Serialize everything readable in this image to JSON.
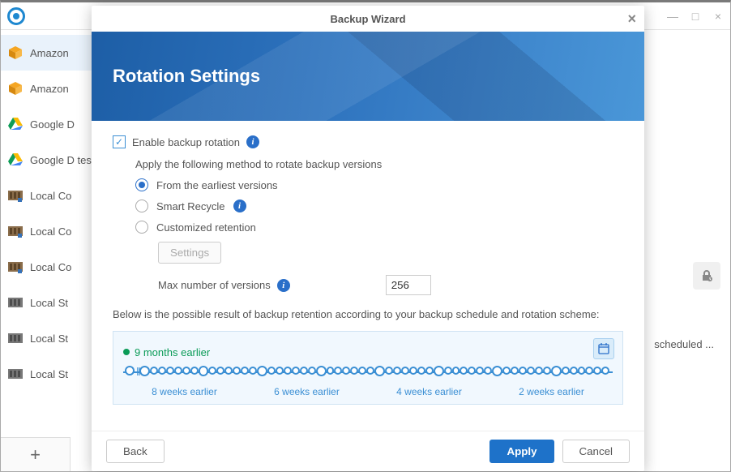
{
  "bg_window": {
    "controls": {
      "min": "—",
      "max": "□",
      "close": "×"
    }
  },
  "sidebar": {
    "items": [
      {
        "label": "Amazon"
      },
      {
        "label": "Amazon"
      },
      {
        "label": "Google D"
      },
      {
        "label": "Google D test"
      },
      {
        "label": "Local Co"
      },
      {
        "label": "Local Co"
      },
      {
        "label": "Local Co"
      },
      {
        "label": "Local St"
      },
      {
        "label": "Local St"
      },
      {
        "label": "Local St"
      }
    ]
  },
  "main": {
    "scheduled_text": "scheduled ..."
  },
  "modal": {
    "title": "Backup Wizard",
    "banner_title": "Rotation Settings",
    "enable_label": "Enable backup rotation",
    "apply_method_text": "Apply the following method to rotate backup versions",
    "radios": {
      "earliest": "From the earliest versions",
      "smart": "Smart Recycle",
      "custom": "Customized retention"
    },
    "settings_btn": "Settings",
    "max_versions_label": "Max number of versions",
    "max_versions_value": "256",
    "desc": "Below is the possible result of backup retention according to your backup schedule and rotation scheme:",
    "timeline": {
      "earliest_label": "9 months earlier",
      "ticks": [
        "8 weeks earlier",
        "6 weeks earlier",
        "4 weeks earlier",
        "2 weeks earlier"
      ]
    },
    "footer": {
      "back": "Back",
      "apply": "Apply",
      "cancel": "Cancel"
    }
  }
}
